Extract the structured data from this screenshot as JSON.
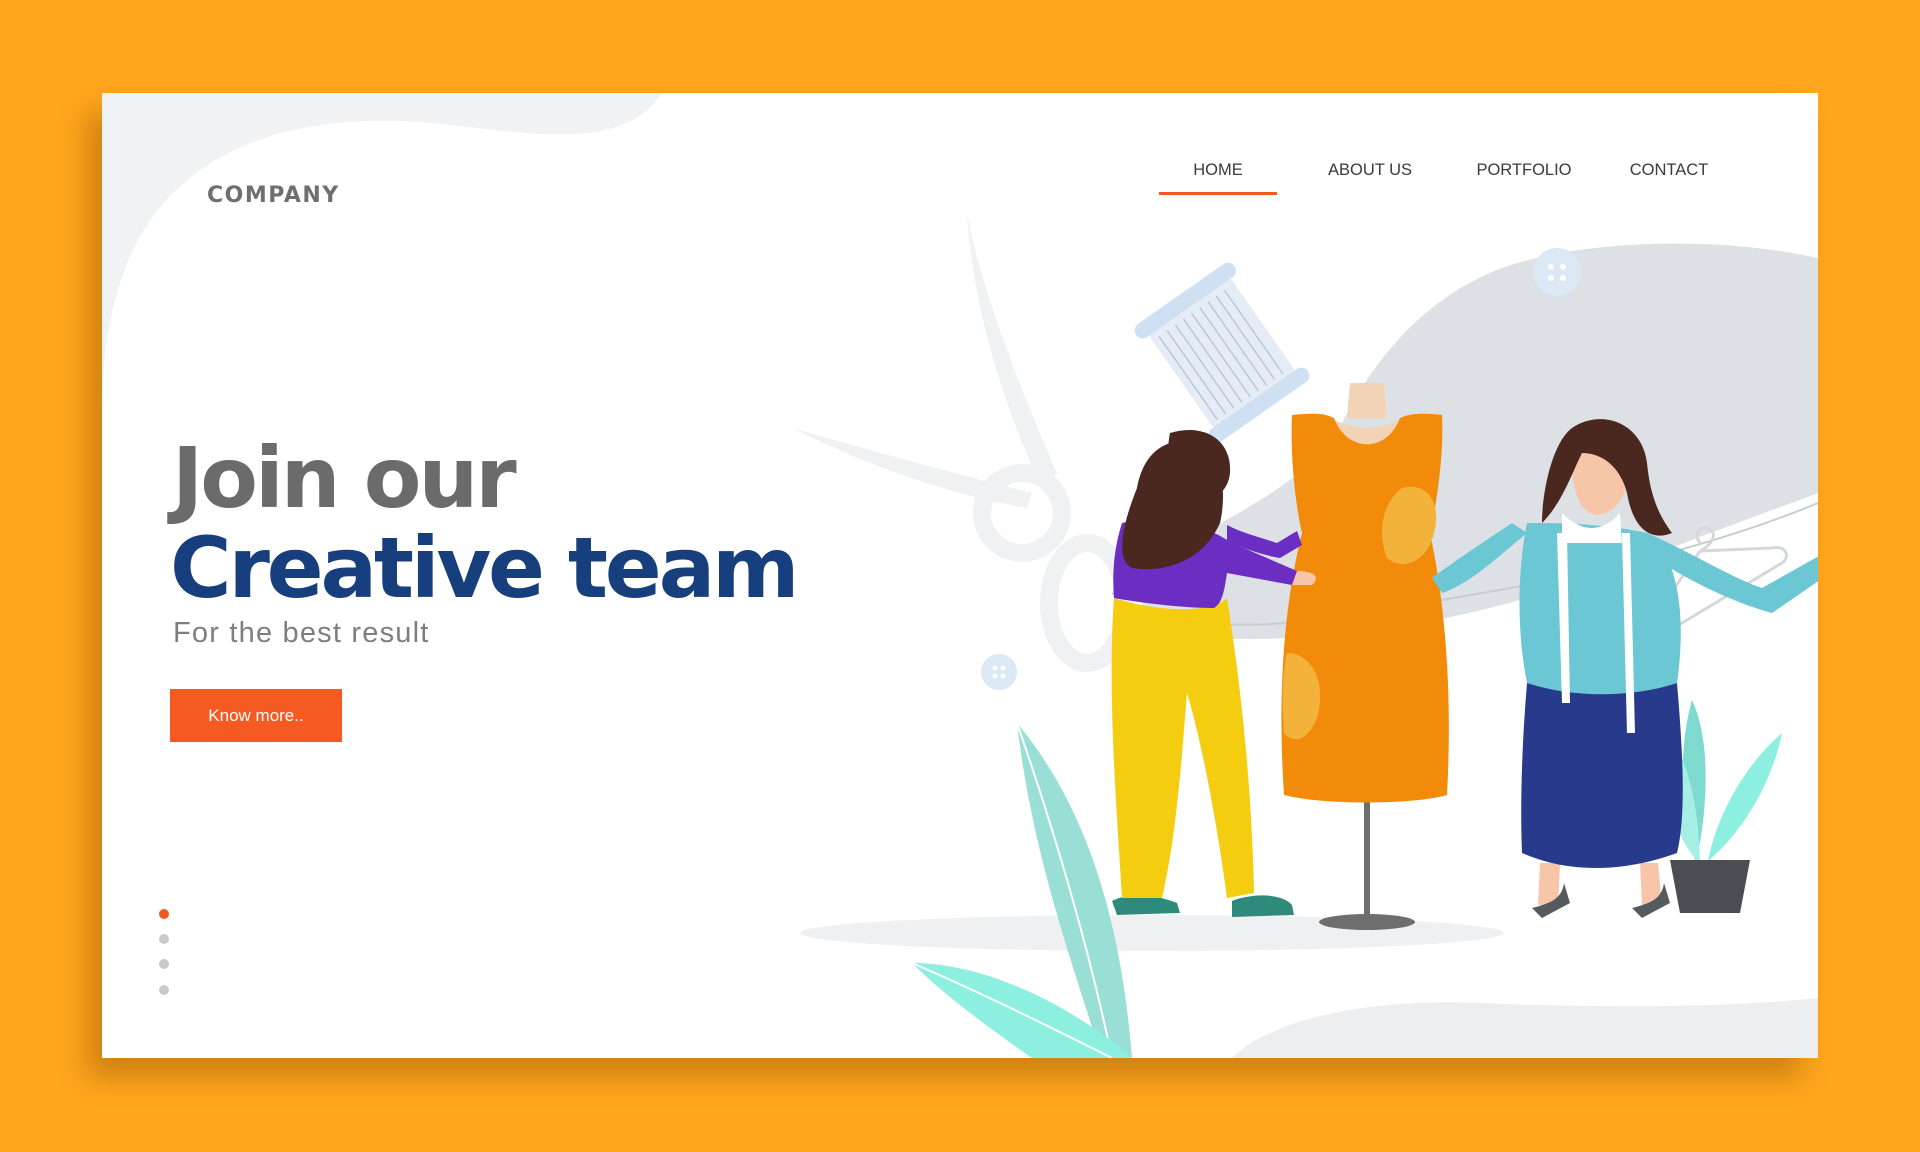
{
  "brand": {
    "logo_text": "COMPANY"
  },
  "nav": {
    "items": [
      {
        "label": "HOME",
        "active": true
      },
      {
        "label": "ABOUT US",
        "active": false
      },
      {
        "label": "PORTFOLIO",
        "active": false
      },
      {
        "label": "CONTACT",
        "active": false
      }
    ]
  },
  "hero": {
    "line1": "Join our",
    "line2": "Creative team",
    "subtitle": "For the best result",
    "cta_label": "Know more.."
  },
  "slider": {
    "count": 4,
    "active_index": 0
  },
  "colors": {
    "background": "#FFA61C",
    "card": "#FFFFFF",
    "accent": "#F55A22",
    "heading_gray": "#6B6B6B",
    "heading_blue": "#173E7D",
    "nav_text": "#3A3A3A"
  },
  "illustration": {
    "scene": "two-women-fitting-dress-on-mannequin",
    "icons": [
      "scissors-icon",
      "thread-spool-icon",
      "button-icon",
      "hanger-icon",
      "potted-plant-icon",
      "leaf-icon"
    ]
  }
}
